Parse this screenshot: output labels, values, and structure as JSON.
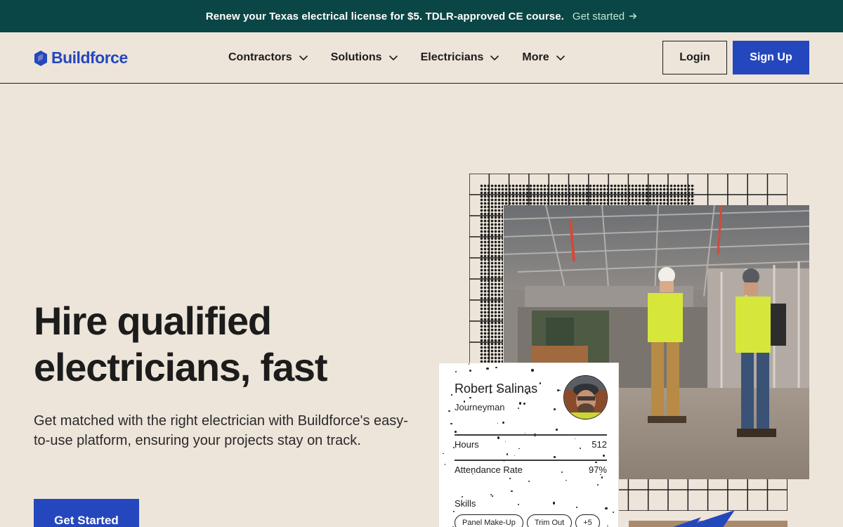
{
  "banner": {
    "message": "Renew your Texas electrical license for $5. TDLR-approved CE course.",
    "cta_label": "Get started",
    "cta_icon": "arrow-right-icon"
  },
  "header": {
    "logo_text": "Buildforce",
    "logo_icon": "hexagon-logo-icon",
    "nav": [
      {
        "label": "Contractors",
        "icon": "chevron-down-icon"
      },
      {
        "label": "Solutions",
        "icon": "chevron-down-icon"
      },
      {
        "label": "Electricians",
        "icon": "chevron-down-icon"
      },
      {
        "label": "More",
        "icon": "chevron-down-icon"
      }
    ],
    "login_label": "Login",
    "signup_label": "Sign Up"
  },
  "hero": {
    "title_line1": "Hire qualified",
    "title_line2": "electricians, fast",
    "subtitle": "Get matched with the right electrician with Buildforce's easy-to-use platform, ensuring your projects stay on track.",
    "cta_label": "Get Started"
  },
  "profile_card": {
    "name": "Robert Salinas",
    "role": "Journeyman",
    "stats": [
      {
        "label": "Hours",
        "value": "512"
      },
      {
        "label": "Attendance Rate",
        "value": "97%"
      }
    ],
    "skills_label": "Skills",
    "skills": [
      "Panel Make-Up",
      "Trim Out",
      "+5"
    ]
  },
  "colors": {
    "banner_bg": "#0b4646",
    "brand_blue": "#2547bd",
    "page_bg": "#ede5da",
    "banner_cta": "#bfe7cf"
  }
}
